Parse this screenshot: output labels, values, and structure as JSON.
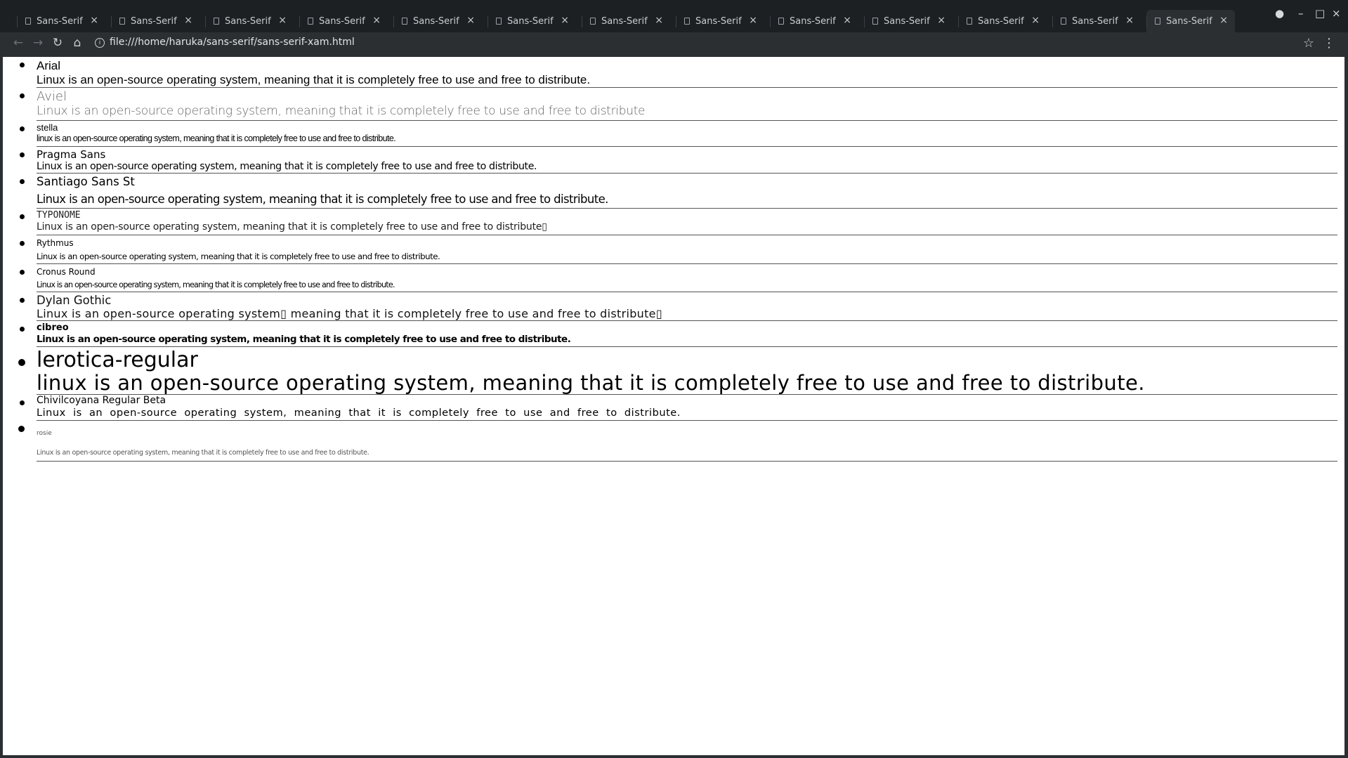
{
  "tabs": [
    {
      "title": "Sans-Serif",
      "close": "×"
    },
    {
      "title": "Sans-Serif",
      "close": "×"
    },
    {
      "title": "Sans-Serif",
      "close": "×"
    },
    {
      "title": "Sans-Serif",
      "close": "×"
    },
    {
      "title": "Sans-Serif",
      "close": "×"
    },
    {
      "title": "Sans-Serif",
      "close": "×"
    },
    {
      "title": "Sans-Serif",
      "close": "×"
    },
    {
      "title": "Sans-Serif",
      "close": "×"
    },
    {
      "title": "Sans-Serif",
      "close": "×"
    },
    {
      "title": "Sans-Serif",
      "close": "×"
    },
    {
      "title": "Sans-Serif",
      "close": "×"
    },
    {
      "title": "Sans-Serif",
      "close": "×"
    },
    {
      "title": "Sans-Serif",
      "close": "×"
    }
  ],
  "active_tab_index": 12,
  "window_controls": {
    "profile": "●",
    "minimize": "–",
    "maximize": "□",
    "close": "×"
  },
  "toolbar": {
    "back": "←",
    "forward": "→",
    "reload": "↻",
    "home": "⌂",
    "url": "file:///home/haruka/sans-serif/sans-serif-xam.html",
    "info": "i",
    "bookmark": "☆",
    "menu": "⋮"
  },
  "colors": {
    "tabbar": "#1d2023",
    "toolbar": "#2b2f32",
    "page": "#ffffff"
  },
  "fonts": [
    {
      "name": "Arial",
      "sample": "Linux is an open-source operating system, meaning that it is completely free to use and free to distribute."
    },
    {
      "name": "Aviel",
      "sample": "Linux is an open-source operating system, meaning that it is completely free to use and free to distribute"
    },
    {
      "name": "stella",
      "sample": "linux is an open-source operating system, meaning that it is completely free to use and free to distribute."
    },
    {
      "name": "Pragma Sans",
      "sample": "Linux is an open-source operating system, meaning that it is completely free to use and free to distribute."
    },
    {
      "name": "Santiago Sans St",
      "sample": "Linux is an open-source operating system, meaning that it is completely free to use and free to distribute."
    },
    {
      "name": "TYPONOME",
      "sample": "Linux is an open-source operating system, meaning that it is completely free to use and free to distribute▯"
    },
    {
      "name": "Rythmus",
      "sample": "Linux is an open-source operating system, meaning that it is completely free to use and free to distribute."
    },
    {
      "name": "Cronus Round",
      "sample": "Linux is an open-source operating system, meaning that it is completely free to use and free to distribute."
    },
    {
      "name": "Dylan Gothic",
      "sample": "Linux is an open-source operating system▯ meaning that it is completely free to use and free to distribute▯"
    },
    {
      "name": "cibreo",
      "sample": "Linux is an open-source operating system, meaning that it is completely free to use and free to distribute."
    },
    {
      "name": "lerotica-regular",
      "sample": "linux is an open-source operating system, meaning that it is completely free to use and free to distribute."
    },
    {
      "name": "Chivilcoyana Regular Beta",
      "sample": "Linux is an open-source operating system, meaning that it is completely free to use and free to distribute."
    },
    {
      "name": "rosie",
      "sample": "Linux is an open-source operating system, meaning that it is completely free to use and free to distribute."
    }
  ]
}
